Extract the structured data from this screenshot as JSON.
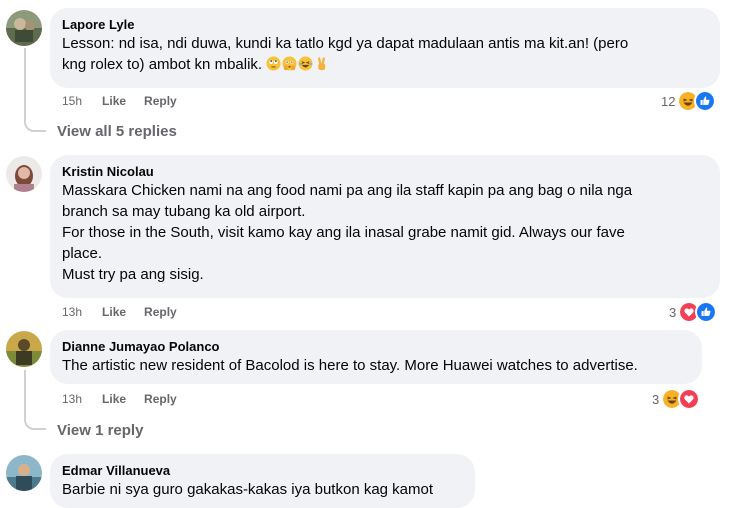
{
  "comments": [
    {
      "author": "Lapore Lyle",
      "lines": [
        "Lesson: nd isa, ndi duwa, kundi ka tatlo kgd ya dapat madulaan antis ma kit.an! (pero",
        "kng rolex to) ambot kn mbalik."
      ],
      "emojis": [
        "rolling-eyes-emoji",
        "flushed-hands-emoji",
        "laughing-emoji",
        "victory-hand-emoji"
      ],
      "time": "15h",
      "like_label": "Like",
      "reply_label": "Reply",
      "reaction_count": "12",
      "reactions": [
        "haha",
        "like"
      ],
      "view_replies": "View all 5 replies"
    },
    {
      "author": "Kristin Nicolau",
      "lines": [
        "Masskara Chicken nami na ang food nami pa ang ila staff kapin pa ang bag o nila nga",
        "branch sa may tubang ka old airport.",
        "For those in the South, visit kamo kay ang ila inasal grabe namit gid. Always our fave",
        "place.",
        "Must try pa ang sisig."
      ],
      "time": "13h",
      "like_label": "Like",
      "reply_label": "Reply",
      "reaction_count": "3",
      "reactions": [
        "love",
        "like"
      ]
    },
    {
      "author": "Dianne Jumayao Polanco",
      "lines": [
        "The artistic new resident of Bacolod is here to stay. More Huawei watches to advertise."
      ],
      "time": "13h",
      "like_label": "Like",
      "reply_label": "Reply",
      "reaction_count": "3",
      "reactions": [
        "haha",
        "love"
      ],
      "view_replies": "View 1 reply"
    },
    {
      "author": "Edmar Villanueva",
      "lines": [
        "Barbie ni sya guro gakakas-kakas iya butkon kag kamot"
      ]
    }
  ],
  "colors": {
    "bubble": "#f0f2f5",
    "secondary_text": "#65676b",
    "like_blue": "#1877f2",
    "love_red": "#f33e58",
    "haha_yellow": "#f7b125"
  }
}
